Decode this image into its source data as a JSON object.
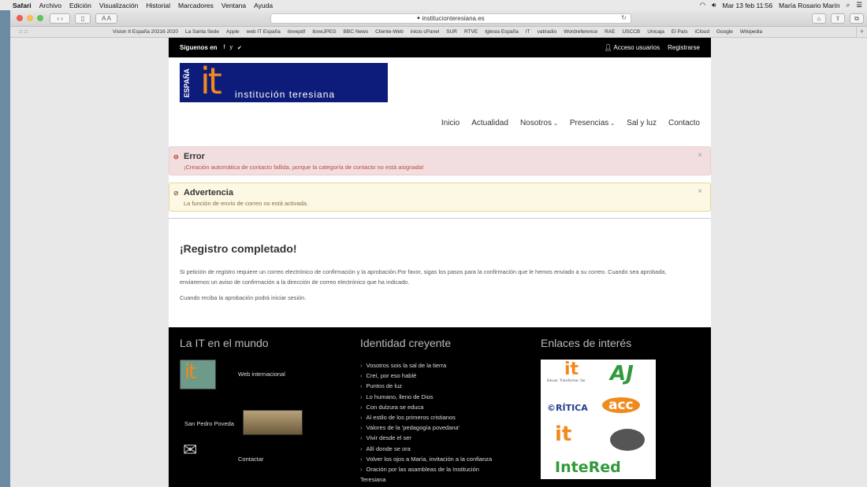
{
  "menubar": {
    "app": "Safari",
    "items": [
      "Archivo",
      "Edición",
      "Visualización",
      "Historial",
      "Marcadores",
      "Ventana",
      "Ayuda"
    ],
    "datetime": "Mar 13 feb  11:56",
    "user": "María Rosario Marín"
  },
  "browser": {
    "url": "institucionteresiana.es",
    "bookmarks": [
      "Vision It España 20216 2020",
      "La Santa Sede",
      "Apple",
      "web IT España",
      "ilovepdf",
      "iloveJPEG",
      "BBC News",
      "Cliente-Web",
      "inicio cPanel",
      "SUR",
      "RTVE",
      "Iglesia España",
      "IT",
      "vatiradio",
      "Wordreference",
      "RAE",
      "USCCB",
      "Unicaja",
      "El País",
      "iCloud",
      "Google",
      "Wikipedia"
    ]
  },
  "topbar": {
    "follow": "Síguenos en",
    "social": [
      "f",
      "y",
      "✔"
    ],
    "login": "Acceso usuarios",
    "register": "Registrarse"
  },
  "logo": {
    "vertical": "ESPAÑA",
    "mark": "it",
    "name": "institución teresiana"
  },
  "nav": {
    "items": [
      "Inicio",
      "Actualidad",
      "Nosotros",
      "Presencias",
      "Sal y luz",
      "Contacto"
    ]
  },
  "alerts": {
    "error": {
      "title": "Error",
      "message": "¡Creación automática de contacto fallida, porque la categoría de contacto no está asignada!"
    },
    "warning": {
      "title": "Advertencia",
      "message": "La función de envío de correo no está activada."
    }
  },
  "content": {
    "heading": "¡Registro completado!",
    "p1": "Si petición de registro requiere un correo electrónico de confirmación y la aprobación.Por favor, sigas los pasos para la confirmación que le hemos enviado a su correo. Cuando sea aprobada, enviaremos un aviso de confirmación a la dirección de correo electrónico que ha indicado.",
    "p2": "Cuando reciba la aprobación podrá iniciar sesión."
  },
  "footer": {
    "col1": {
      "title": "La IT en el mundo",
      "thumb": "it",
      "web": "Web internacional",
      "poveda": "San Pedro Poveda",
      "contact": "Contactar"
    },
    "col2": {
      "title": "Identidad creyente",
      "items": [
        "Vosotros sois la sal de la tierra",
        "Creí, por eso hablé",
        "Puntos de luz",
        "Lo humano, lleno de Dios",
        "Con dulzura se educa",
        "Al estilo de los primeros cristianos",
        "Valores de la 'pedagogía povedana'",
        "Vivir desde el ser",
        "Allí donde se ora",
        "Volver los ojos a María, invitación a la confianza",
        "Oración por las asambleas de la Institución Teresiana"
      ]
    },
    "col3": {
      "title": "Enlaces de interés",
      "logos": [
        "it",
        "Educar. Transformar. Ser",
        "AJ",
        "©RÍTICA",
        "acc",
        "it",
        "InteRed"
      ]
    }
  },
  "colors": {
    "logo_bg": "#0d1b7a",
    "orange": "#f08a1c",
    "error_bg": "#f2dede",
    "warning_bg": "#fcf8e3"
  }
}
